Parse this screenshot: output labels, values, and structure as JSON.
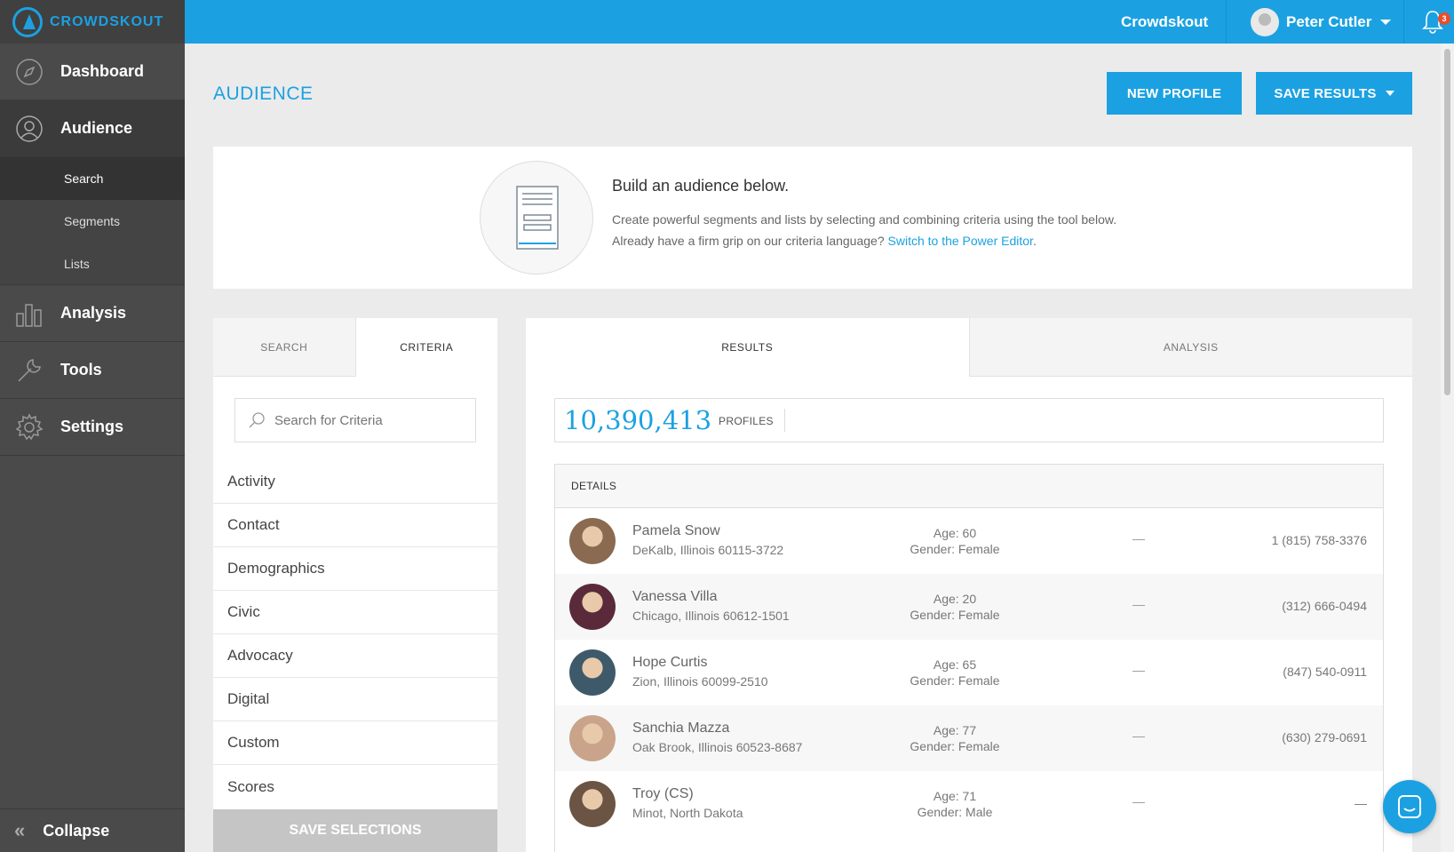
{
  "brand": {
    "name": "CROWDSKOUT"
  },
  "sidebar": {
    "items": [
      {
        "label": "Dashboard",
        "icon": "compass-icon"
      },
      {
        "label": "Audience",
        "icon": "user-circle-icon"
      },
      {
        "label": "Analysis",
        "icon": "bar-chart-icon"
      },
      {
        "label": "Tools",
        "icon": "wrench-icon"
      },
      {
        "label": "Settings",
        "icon": "gear-icon"
      }
    ],
    "subitems": [
      "Search",
      "Segments",
      "Lists"
    ],
    "collapse_label": "Collapse"
  },
  "topbar": {
    "org": "Crowdskout",
    "user": "Peter Cutler",
    "notifications": "3"
  },
  "page": {
    "title": "AUDIENCE",
    "new_profile": "NEW PROFILE",
    "save_results": "SAVE RESULTS"
  },
  "intro": {
    "title": "Build an audience below.",
    "line1": "Create powerful segments and lists by selecting and combining criteria using the tool below.",
    "line2": "Already have a firm grip on our criteria language?",
    "link": "Switch to the Power Editor",
    "link_tail": "."
  },
  "criteria_panel": {
    "tabs": [
      "SEARCH",
      "CRITERIA"
    ],
    "search_placeholder": "Search for Criteria",
    "items": [
      "Activity",
      "Contact",
      "Demographics",
      "Civic",
      "Advocacy",
      "Digital",
      "Custom",
      "Scores"
    ],
    "save_label": "SAVE SELECTIONS"
  },
  "results_panel": {
    "tabs": [
      "RESULTS",
      "ANALYSIS"
    ],
    "count": "10,390,413",
    "count_label": "PROFILES",
    "details_label": "DETAILS",
    "rows": [
      {
        "name": "Pamela Snow",
        "location": "DeKalb, Illinois 60115-3722",
        "age": "Age: 60",
        "gender": "Gender: Female",
        "dash": "—",
        "phone": "1 (815) 758-3376",
        "color": "#8a6a50"
      },
      {
        "name": "Vanessa Villa",
        "location": "Chicago, Illinois 60612-1501",
        "age": "Age: 20",
        "gender": "Gender: Female",
        "dash": "—",
        "phone": "(312) 666-0494",
        "color": "#5a2a3a"
      },
      {
        "name": "Hope Curtis",
        "location": "Zion, Illinois 60099-2510",
        "age": "Age: 65",
        "gender": "Gender: Female",
        "dash": "—",
        "phone": "(847) 540-0911",
        "color": "#3e5a6a"
      },
      {
        "name": "Sanchia Mazza",
        "location": "Oak Brook, Illinois 60523-8687",
        "age": "Age: 77",
        "gender": "Gender: Female",
        "dash": "—",
        "phone": "(630) 279-0691",
        "color": "#c9a48a"
      },
      {
        "name": "Troy (CS)",
        "location": "Minot, North Dakota",
        "age": "Age: 71",
        "gender": "Gender: Male",
        "dash": "—",
        "phone": "—",
        "color": "#6b5444"
      }
    ]
  },
  "colors": {
    "accent": "#1ba1e2",
    "sidebar": "#4a4a4a"
  }
}
